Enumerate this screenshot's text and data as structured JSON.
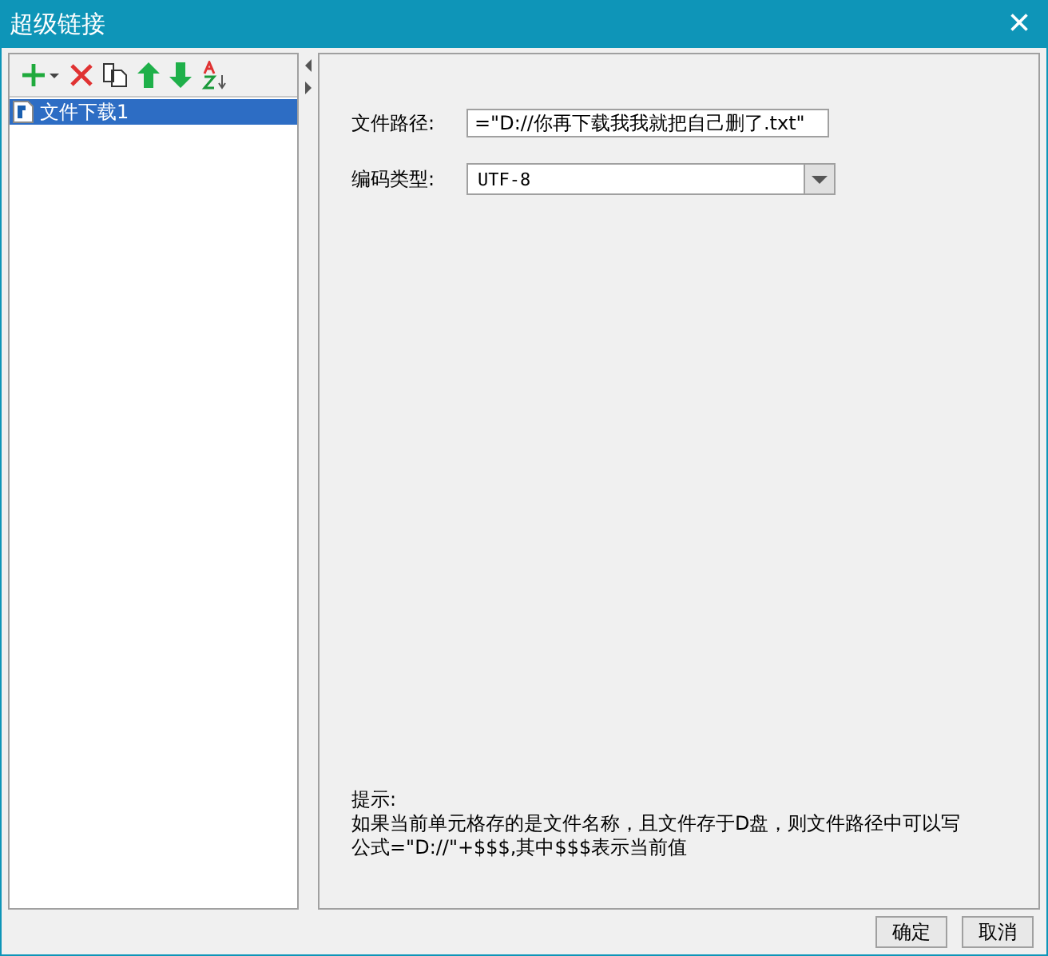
{
  "window": {
    "title": "超级链接",
    "close": "×"
  },
  "list": {
    "items": [
      {
        "label": "文件下载1",
        "selected": true
      }
    ]
  },
  "form": {
    "fields": [
      {
        "kind": "text",
        "label": "文件路径:",
        "value": "=\"D://你再下载我我就把自己删了.txt\""
      },
      {
        "kind": "select",
        "label": "编码类型:",
        "value": "UTF-8"
      }
    ]
  },
  "hint": {
    "lines": [
      "提示:",
      "如果当前单元格存的是文件名称，且文件存于D盘，则文件路径中可以写",
      "公式=\"D://\"+$$$,其中$$$表示当前值"
    ]
  },
  "buttons": [
    "确定",
    "取消"
  ]
}
